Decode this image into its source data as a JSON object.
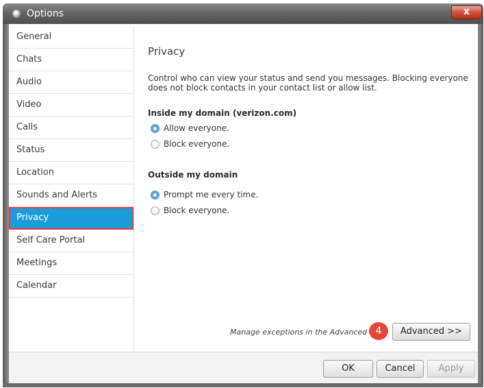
{
  "window": {
    "title": "Options",
    "close_symbol": "x"
  },
  "sidebar": {
    "items": [
      {
        "label": "General"
      },
      {
        "label": "Chats"
      },
      {
        "label": "Audio"
      },
      {
        "label": "Video"
      },
      {
        "label": "Calls"
      },
      {
        "label": "Status"
      },
      {
        "label": "Location"
      },
      {
        "label": "Sounds and Alerts"
      },
      {
        "label": "Privacy",
        "selected": true
      },
      {
        "label": "Self Care Portal"
      },
      {
        "label": "Meetings"
      },
      {
        "label": "Calendar"
      }
    ]
  },
  "privacy": {
    "title": "Privacy",
    "description": "Control who can view your status and send you messages. Blocking everyone does not block contacts in your contact list or allow list.",
    "inside": {
      "heading": "Inside my domain (verizon.com)",
      "options": [
        {
          "label": "Allow everyone.",
          "checked": true
        },
        {
          "label": "Block everyone.",
          "checked": false
        }
      ]
    },
    "outside": {
      "heading": "Outside my domain",
      "options": [
        {
          "label": "Prompt me every time.",
          "checked": true
        },
        {
          "label": "Block everyone.",
          "checked": false
        }
      ]
    },
    "manage_text": "Manage exceptions in the Advanced vi",
    "step_badge": "4",
    "advanced_label": "Advanced >>"
  },
  "footer": {
    "ok_label": "OK",
    "cancel_label": "Cancel",
    "apply_label": "Apply"
  },
  "colors": {
    "selection": "#1d9cdb",
    "highlight_outline": "#e5413a",
    "badge": "#e5473b"
  }
}
